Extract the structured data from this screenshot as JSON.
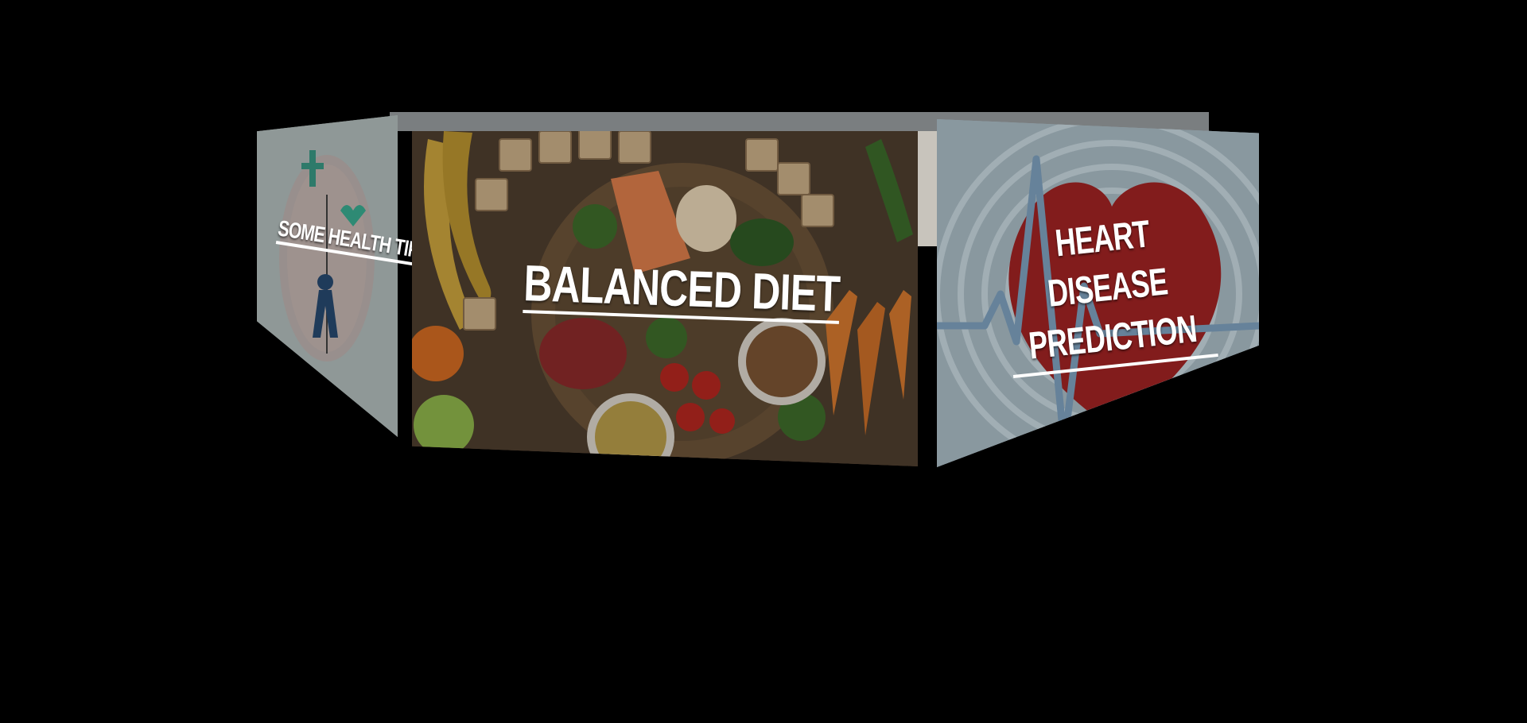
{
  "carousel": {
    "items": [
      {
        "id": "health-tips",
        "label": "SOME HEALTH TIPS"
      },
      {
        "id": "balanced-diet",
        "label": "BALANCED DIET"
      },
      {
        "id": "heart-disease",
        "label": "HEART DISEASE PREDICTION"
      }
    ]
  },
  "colors": {
    "background": "#000000",
    "caption": "#ffffff",
    "health_panel": "#8f9897",
    "diet_panel": "#5b4938",
    "heart_panel": "#95a5ad",
    "heart_red": "#8e1f1f"
  }
}
